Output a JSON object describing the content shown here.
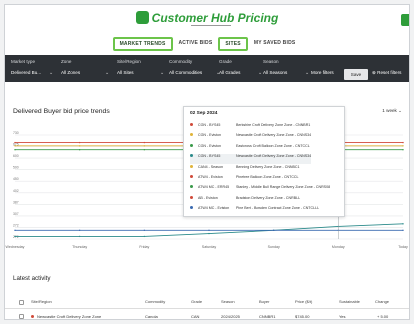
{
  "header": {
    "app_title": "Customer Hub Pricing",
    "tabs": [
      "MARKET TRENDS",
      "ACTIVE BIDS",
      "SITES",
      "MY SAVED BIDS"
    ]
  },
  "filters": {
    "market_type": {
      "label": "Market type",
      "value": "Delivered Bu..."
    },
    "zone": {
      "label": "Zone",
      "value": "All Zones"
    },
    "site_region": {
      "label": "Site/Region",
      "value": "All Sites"
    },
    "commodity": {
      "label": "Commodity",
      "value": "All Commodities"
    },
    "grade": {
      "label": "Grade",
      "value": "All Grades"
    },
    "season": {
      "label": "Season",
      "value": "All Seasons"
    },
    "more_filters": "More filters",
    "apply": "Save",
    "reset": "Reset filters"
  },
  "chart": {
    "title": "Delivered Buyer bid price trends",
    "range": "1 week"
  },
  "chart_data": {
    "type": "line",
    "categories": [
      "Wednesday",
      "Thursday",
      "Friday",
      "Saturday",
      "Sunday",
      "Monday",
      "Today"
    ],
    "y_ticks": [
      "730",
      "675",
      "600",
      "500",
      "450",
      "402",
      "387",
      "307",
      "272",
      "272"
    ],
    "series": [
      {
        "name": "series-red",
        "color": "#d04a3a",
        "values": [
          705,
          705,
          705,
          705,
          705,
          705,
          705
        ]
      },
      {
        "name": "series-yellow",
        "color": "#e0b43a",
        "values": [
          690,
          690,
          690,
          690,
          690,
          690,
          690
        ]
      },
      {
        "name": "series-green",
        "color": "#3a9a4a",
        "values": [
          672,
          672,
          672,
          672,
          672,
          672,
          672
        ]
      },
      {
        "name": "series-teal",
        "color": "#2a8a8a",
        "values": [
          272,
          272,
          272,
          285,
          300,
          318,
          330
        ]
      },
      {
        "name": "series-blue",
        "color": "#3a6ab0",
        "values": [
          300,
          300,
          300,
          300,
          300,
          300,
          300
        ]
      }
    ]
  },
  "tooltip": {
    "date": "02 Sep 2024",
    "rows": [
      {
        "color": "#d04a3a",
        "label": "CGN - BYS45",
        "text": "Berkshire Croft Delivery Zone Zone - CNNBR1"
      },
      {
        "color": "#e0b43a",
        "label": "CGN - Eviston",
        "text": "Newcastle Croft Delivery Zone Zone - CNNS34"
      },
      {
        "color": "#3a9a4a",
        "label": "CGN - Eviston",
        "text": "Eastcross Croft Balloon Zone Zone - CNTCCL"
      },
      {
        "color": "#2a8a8a",
        "label": "CGN - BYS45",
        "text": "Newcastle Croft Delivery Zone Zone - CNNS34"
      },
      {
        "color": "#e0b43a",
        "label": "CAN4 - Season",
        "text": "Benning Delivery Zone Zone - CNNBC1"
      },
      {
        "color": "#d04a3a",
        "label": "ATW4 - Eviston",
        "text": "Pinetree Balloon Zone Zone - CNTCCL"
      },
      {
        "color": "#3a9a4a",
        "label": "ATW4 MC - ERR45",
        "text": "Stanley - Middle Bull Range Delivery Zone Zone - CNRS08"
      },
      {
        "color": "#d04a3a",
        "label": "AB - Eviston",
        "text": "Bradston Delivery Zone Zone - CNRBLL"
      },
      {
        "color": "#3a6ab0",
        "label": "ATW4 MC - Eviston",
        "text": "Pine Bert - Bowden Contract Zone Zone - CNTCLLL"
      }
    ]
  },
  "latest": {
    "title": "Latest activity",
    "columns": [
      "Site/Region",
      "Commodity",
      "Grade",
      "Season",
      "Buyer",
      "Price ($/t)",
      "Sustainable",
      "Change"
    ],
    "rows": [
      {
        "site": "Newcastle Croft Delivery Zone Zone",
        "commodity": "Canola",
        "grade": "CAN",
        "season": "2024/2025",
        "buyer": "CNNBR1",
        "price": "$745.00",
        "sustainable": "Yes",
        "change": "+ 5.00"
      }
    ]
  }
}
